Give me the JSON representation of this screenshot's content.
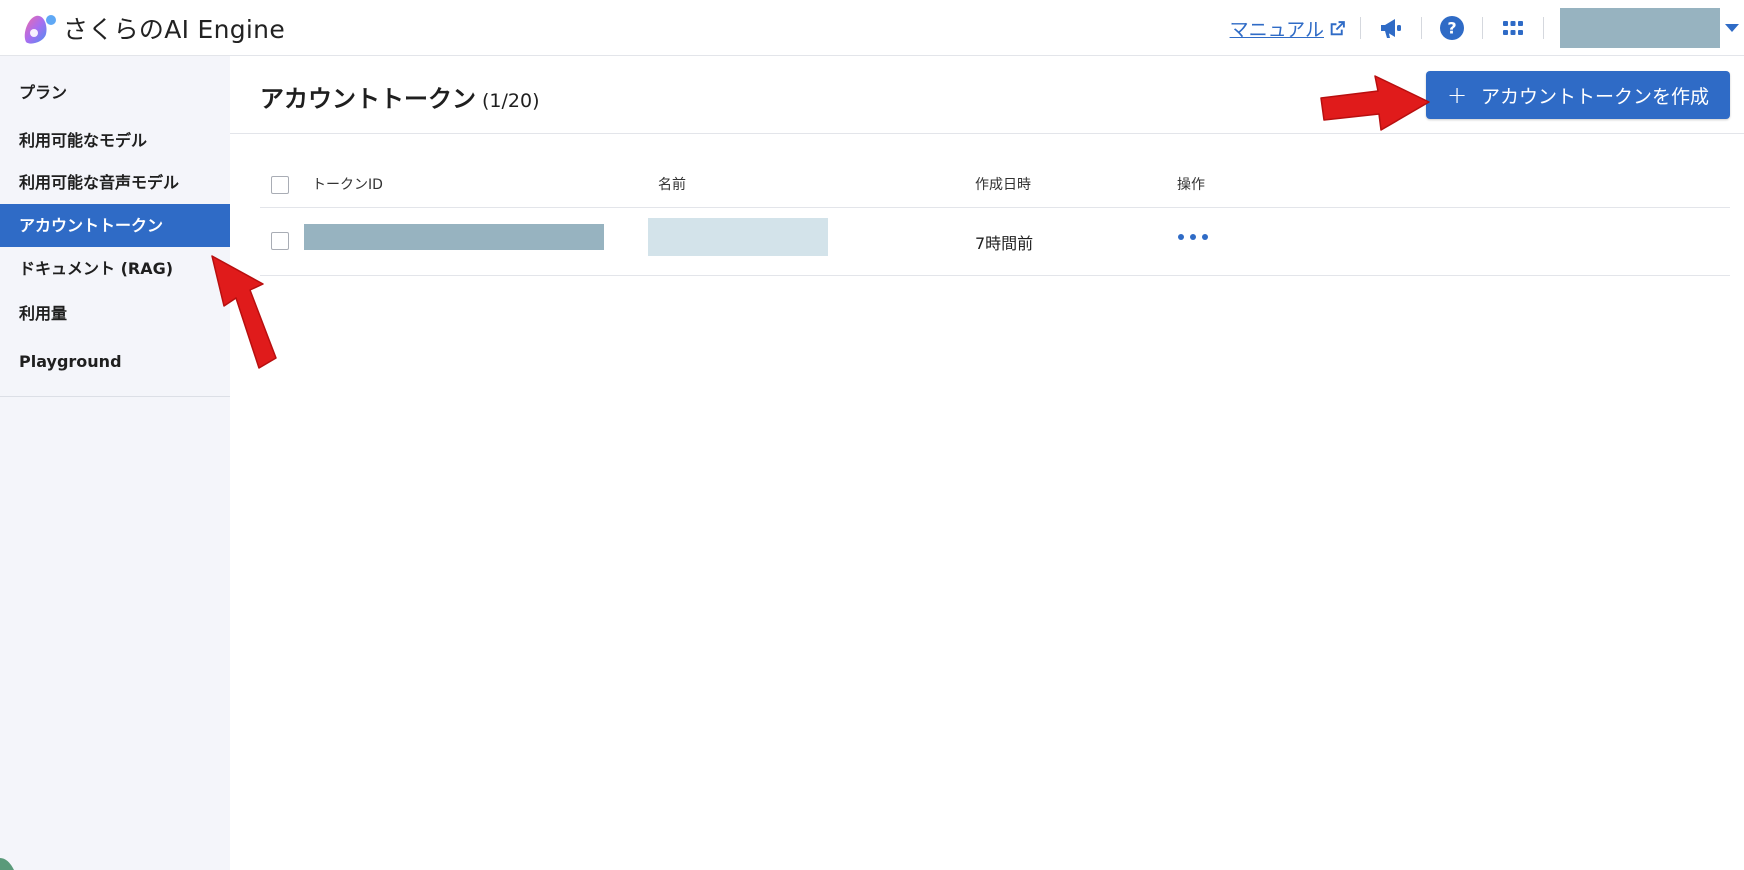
{
  "app": {
    "logo_text": "さくらのAI Engine",
    "accent_color": "#2f6bc6"
  },
  "topbar": {
    "manual_label": "マニュアル",
    "icons": [
      "external-link-icon",
      "megaphone-icon",
      "help-icon",
      "apps-grid-icon",
      "chevron-down-icon"
    ]
  },
  "sidebar": {
    "items": [
      {
        "label": "プラン",
        "active": false
      },
      {
        "label": "利用可能なモデル",
        "active": false
      },
      {
        "label": "利用可能な音声モデル",
        "active": false
      },
      {
        "label": "アカウントトークン",
        "active": true
      },
      {
        "label": "ドキュメント (RAG)",
        "active": false
      },
      {
        "label": "利用量",
        "active": false
      },
      {
        "label": "Playground",
        "active": false
      }
    ]
  },
  "page": {
    "title": "アカウントトークン",
    "count": "(1/20)",
    "create_button_label": "アカウントトークンを作成",
    "create_button_icon": "plus-icon"
  },
  "table": {
    "columns": [
      "トークンID",
      "名前",
      "作成日時",
      "操作"
    ],
    "rows": [
      {
        "token_id": "",
        "name": "",
        "created": "7時間前",
        "action_icon": "more-horizontal-icon"
      }
    ]
  },
  "annotations": {
    "arrow_color": "#e01b1b"
  }
}
